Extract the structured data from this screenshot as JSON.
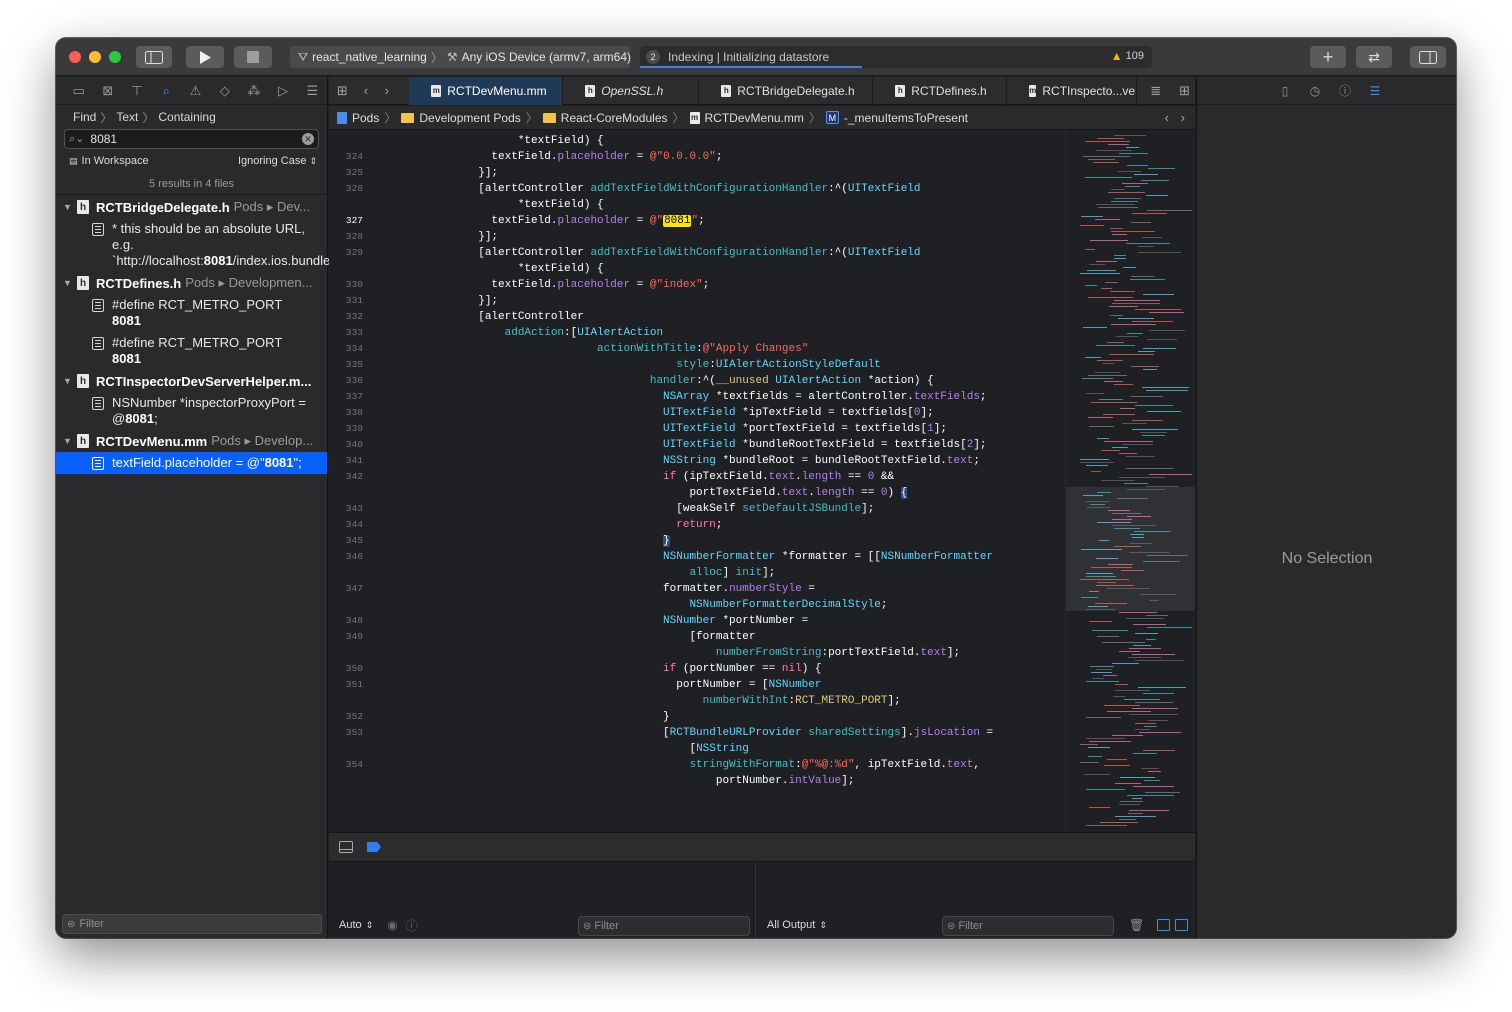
{
  "toolbar": {
    "scheme_project": "react_native_learning",
    "scheme_device": "Any iOS Device (armv7, arm64)",
    "activity_count": "2",
    "activity_text": "Indexing | Initializing datastore",
    "warning_count": "109",
    "colors": {
      "close": "#ff5f57",
      "minimize": "#febc2e",
      "zoom": "#28c840",
      "accent": "#0a60ff"
    }
  },
  "navigator": {
    "path": [
      "Find",
      "Text",
      "Containing"
    ],
    "search_value": "8081",
    "scope": "In Workspace",
    "case_mode": "Ignoring Case",
    "summary": "5 results in 4 files",
    "filter_placeholder": "Filter",
    "groups": [
      {
        "file": "RCTBridgeDelegate.h",
        "path": "Pods ▸ Dev...",
        "matches": [
          {
            "pre": "* this should be an absolute URL, e.g. `http://localhost:",
            "hit": "8081",
            "post": "/index.ios.bundle`."
          }
        ]
      },
      {
        "file": "RCTDefines.h",
        "path": "Pods ▸ Developmen...",
        "matches": [
          {
            "pre": "#define RCT_METRO_PORT ",
            "hit": "8081",
            "post": ""
          },
          {
            "pre": "#define RCT_METRO_PORT ",
            "hit": "8081",
            "post": ""
          }
        ]
      },
      {
        "file": "RCTInspectorDevServerHelper.m...",
        "path": "",
        "matches": [
          {
            "pre": "NSNumber *inspectorProxyPort = @",
            "hit": "8081",
            "post": ";"
          }
        ]
      },
      {
        "file": "RCTDevMenu.mm",
        "path": "Pods ▸ Develop...",
        "matches": [
          {
            "pre": "textField.placeholder = @\"",
            "hit": "8081",
            "post": "\";"
          }
        ]
      }
    ]
  },
  "editor": {
    "tabs": [
      {
        "label": "RCTDevMenu.mm",
        "active": true,
        "italic": false
      },
      {
        "label": "OpenSSL.h",
        "active": false,
        "italic": true
      },
      {
        "label": "RCTBridgeDelegate.h",
        "active": false,
        "italic": false
      },
      {
        "label": "RCTDefines.h",
        "active": false,
        "italic": false
      },
      {
        "label": "RCTInspecto...ver",
        "active": false,
        "italic": false
      }
    ],
    "jumpbar": [
      "Pods",
      "Development Pods",
      "React-CoreModules",
      "RCTDevMenu.mm",
      "-_menuItemsToPresent"
    ],
    "lines": [
      {
        "num": "",
        "html": "                  *textField) {"
      },
      {
        "num": "324",
        "html": "              textField.<span class=\"p\">placeholder</span> = <span class=\"s\">@\"0.0.0.0\"</span>;"
      },
      {
        "num": "325",
        "html": "            }];"
      },
      {
        "num": "326",
        "html": "            [alertController <span class=\"m\">addTextFieldWithConfigurationHandler</span>:^(<span class=\"t\">UITextField</span>"
      },
      {
        "num": "",
        "html": "                  *textField) {"
      },
      {
        "num": "327",
        "html": "              textField.<span class=\"p\">placeholder</span> = <span class=\"s\">@\"</span><span class=\"hl\">8081</span><span class=\"s\">\"</span>;",
        "current": true
      },
      {
        "num": "328",
        "html": "            }];"
      },
      {
        "num": "329",
        "html": "            [alertController <span class=\"m\">addTextFieldWithConfigurationHandler</span>:^(<span class=\"t\">UITextField</span>"
      },
      {
        "num": "",
        "html": "                  *textField) {"
      },
      {
        "num": "330",
        "html": "              textField.<span class=\"p\">placeholder</span> = <span class=\"s\">@\"index\"</span>;"
      },
      {
        "num": "331",
        "html": "            }];"
      },
      {
        "num": "332",
        "html": "            [alertController"
      },
      {
        "num": "333",
        "html": "                <span class=\"m\">addAction</span>:[<span class=\"t\">UIAlertAction</span>"
      },
      {
        "num": "334",
        "html": "                              <span class=\"m\">actionWithTitle</span>:<span class=\"s\">@\"Apply Changes\"</span>"
      },
      {
        "num": "335",
        "html": "                                          <span class=\"m\">style</span>:<span class=\"t\">UIAlertActionStyleDefault</span>"
      },
      {
        "num": "336",
        "html": "                                      <span class=\"m\">handler</span>:^(<span class=\"n\">__unused</span> <span class=\"t\">UIAlertAction</span> *action) {"
      },
      {
        "num": "337",
        "html": "                                        <span class=\"t\">NSArray</span> *textfields = alertController.<span class=\"p\">textFields</span>;"
      },
      {
        "num": "338",
        "html": "                                        <span class=\"t\">UITextField</span> *ipTextField = textfields[<span class=\"p\">0</span>];"
      },
      {
        "num": "339",
        "html": "                                        <span class=\"t\">UITextField</span> *portTextField = textfields[<span class=\"p\">1</span>];"
      },
      {
        "num": "340",
        "html": "                                        <span class=\"t\">UITextField</span> *bundleRootTextField = textfields[<span class=\"p\">2</span>];"
      },
      {
        "num": "341",
        "html": "                                        <span class=\"t\">NSString</span> *bundleRoot = bundleRootTextField.<span class=\"p\">text</span>;"
      },
      {
        "num": "342",
        "html": "                                        <span class=\"k\">if</span> (ipTextField.<span class=\"p\">text</span>.<span class=\"p\">length</span> == <span class=\"p\">0</span> &amp;&amp;"
      },
      {
        "num": "",
        "html": "                                            portTextField.<span class=\"p\">text</span>.<span class=\"p\">length</span> == <span class=\"p\">0</span>) <span class=\"brace\">{</span>"
      },
      {
        "num": "343",
        "html": "                                          [weakSelf <span class=\"m\">setDefaultJSBundle</span>];"
      },
      {
        "num": "344",
        "html": "                                          <span class=\"k\">return</span>;"
      },
      {
        "num": "345",
        "html": "                                        <span class=\"brace\">}</span>"
      },
      {
        "num": "346",
        "html": "                                        <span class=\"t\">NSNumberFormatter</span> *formatter = [[<span class=\"t\">NSNumberFormatter</span>"
      },
      {
        "num": "",
        "html": "                                            <span class=\"m\">alloc</span>] <span class=\"m\">init</span>];"
      },
      {
        "num": "347",
        "html": "                                        formatter.<span class=\"p\">numberStyle</span> ="
      },
      {
        "num": "",
        "html": "                                            <span class=\"t\">NSNumberFormatterDecimalStyle</span>;"
      },
      {
        "num": "348",
        "html": "                                        <span class=\"t\">NSNumber</span> *portNumber ="
      },
      {
        "num": "349",
        "html": "                                            [formatter"
      },
      {
        "num": "",
        "html": "                                                <span class=\"m\">numberFromString</span>:portTextField.<span class=\"p\">text</span>];"
      },
      {
        "num": "350",
        "html": "                                        <span class=\"k\">if</span> (portNumber == <span class=\"k\">nil</span>) {"
      },
      {
        "num": "351",
        "html": "                                          portNumber = [<span class=\"t\">NSNumber</span>"
      },
      {
        "num": "",
        "html": "                                              <span class=\"m\">numberWithInt</span>:<span class=\"n\">RCT_METRO_PORT</span>];"
      },
      {
        "num": "352",
        "html": "                                        }"
      },
      {
        "num": "353",
        "html": "                                        [<span class=\"t\">RCTBundleURLProvider</span> <span class=\"m\">sharedSettings</span>].<span class=\"p\">jsLocation</span> ="
      },
      {
        "num": "",
        "html": "                                            [<span class=\"t\">NSString</span>"
      },
      {
        "num": "354",
        "html": "                                            <span class=\"m\">stringWithFormat</span>:<span class=\"s\">@\"%@:%d\"</span>, ipTextField.<span class=\"p\">text</span>,"
      },
      {
        "num": "",
        "html": "                                                portNumber.<span class=\"p\">intValue</span>];"
      }
    ]
  },
  "debug": {
    "auto_label": "Auto",
    "output_label": "All Output",
    "filter_placeholder": "Filter"
  },
  "inspector": {
    "no_selection": "No Selection"
  }
}
